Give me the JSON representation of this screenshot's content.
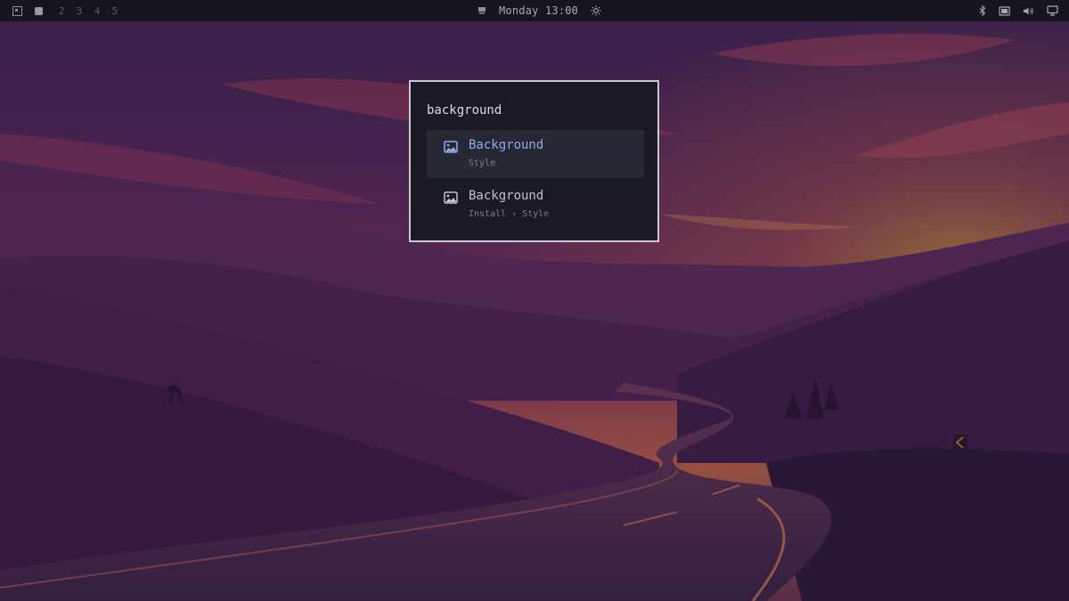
{
  "topbar": {
    "launcher_icon": "app-launcher-icon",
    "active_workspace_icon": "workspace-active-icon",
    "workspaces": [
      "2",
      "3",
      "4",
      "5"
    ],
    "center_icon": "notification-icon",
    "clock": "Monday 13:00",
    "brightness_icon": "brightness-icon",
    "tray_icons": [
      "bluetooth-icon",
      "screenshot-icon",
      "volume-icon",
      "display-icon"
    ]
  },
  "launcher": {
    "query": "background",
    "results": [
      {
        "icon": "image-icon",
        "title": "Background",
        "subtitle": "Style",
        "selected": true
      },
      {
        "icon": "image-icon",
        "title": "Background",
        "subtitle": "Install › Style",
        "selected": false
      }
    ]
  },
  "colors": {
    "bar_bg": "#17161e",
    "launcher_bg": "#191a22",
    "launcher_border": "#c9c8d6",
    "accent": "#8fa9e8",
    "selected_row": "#262834"
  }
}
